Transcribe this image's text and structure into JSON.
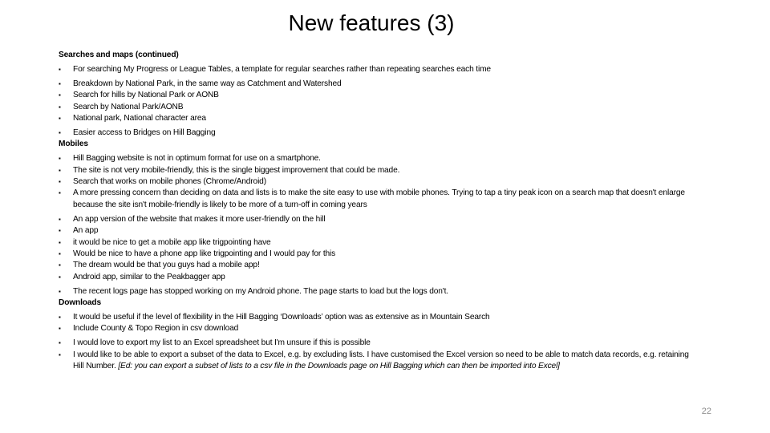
{
  "slide": {
    "title": "New features (3)",
    "page_number": "22"
  },
  "sections": {
    "searches": {
      "heading": "Searches and maps (continued)",
      "items": [
        "For searching My Progress or League Tables, a template for regular searches rather than repeating searches each time",
        "Breakdown by National Park, in the same way as Catchment and Watershed",
        "Search for hills by National Park or AONB",
        "Search by National Park/AONB",
        "National park, National character area",
        "Easier access to Bridges on Hill Bagging"
      ]
    },
    "mobiles": {
      "heading": "Mobiles",
      "items": [
        "Hill Bagging website is not in optimum format for use on a smartphone.",
        "The site is not very mobile-friendly, this is the single biggest improvement that could be made.",
        "Search that works on mobile phones (Chrome/Android)",
        "A more pressing concern than deciding on data and lists is to make the site easy to use with mobile phones. Trying to tap a tiny peak icon on a search map that doesn't enlarge because the site isn't mobile-friendly is likely to be more of a turn-off in coming years",
        "An app version of the website that makes it more user-friendly on the hill",
        "An app",
        "it would be nice to get a mobile app like trigpointing have",
        "Would be nice to have a phone app like trigpointing and I would pay for this",
        "The dream would be that you guys had a mobile app!",
        "Android app, similar to the Peakbagger app",
        "The recent logs page has stopped working on my Android phone. The page starts to load but the logs don't."
      ]
    },
    "downloads": {
      "heading": "Downloads",
      "items": [
        "It would be useful if the level of flexibility in the Hill Bagging ‘Downloads’ option was as extensive as in Mountain Search",
        "Include County & Topo Region in csv download",
        "I would love to export my list to an Excel spreadsheet but I'm unsure if this is possible",
        "I would like to be able to export a subset of the data to Excel, e.g. by excluding lists. I have customised the Excel version so need to be able to match data records, e.g. retaining Hill Number."
      ],
      "editor_note": "[Ed: you can export a subset of lists to a csv file in the Downloads page on Hill Bagging which can then be imported into Excel]"
    }
  }
}
